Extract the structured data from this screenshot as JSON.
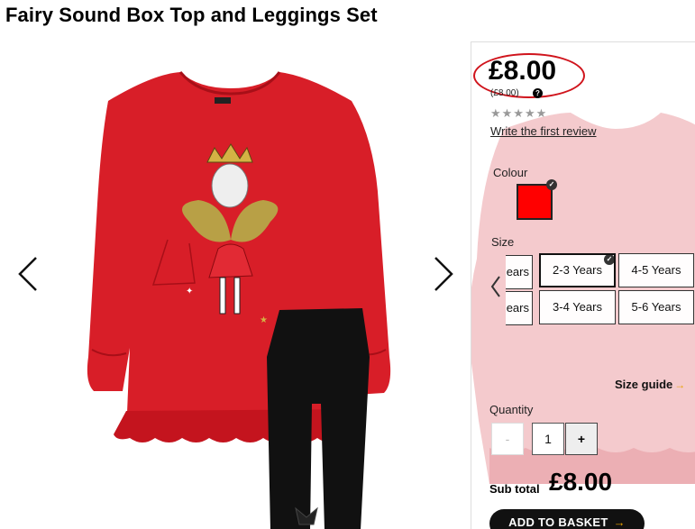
{
  "product": {
    "title": "Fairy Sound Box Top and Leggings Set"
  },
  "gallery": {
    "prev_arrow": "chevron-left-icon",
    "next_arrow": "chevron-right-icon"
  },
  "pricing": {
    "price": "£8.00",
    "unit_price": "(£8.00)",
    "help_icon": "?",
    "stars": "★★★★★",
    "rating_filled": 0,
    "review_link": "Write the first review"
  },
  "colour": {
    "label": "Colour",
    "selected_hex": "#ff0000",
    "check": "✓"
  },
  "size": {
    "label": "Size",
    "options": [
      {
        "label": "ears"
      },
      {
        "label": "2-3 Years"
      },
      {
        "label": "4-5 Years"
      },
      {
        "label": "ears"
      },
      {
        "label": "3-4 Years"
      },
      {
        "label": "5-6 Years"
      }
    ],
    "selected": "2-3 Years",
    "guide": "Size guide",
    "guide_arrow": "→"
  },
  "quantity": {
    "label": "Quantity",
    "minus": "-",
    "value": "1",
    "plus": "+"
  },
  "subtotal": {
    "label": "Sub total",
    "value": "£8.00"
  },
  "basket": {
    "label": "ADD TO BASKET",
    "arrow": "→"
  },
  "colors": {
    "accent_red": "#d0141c",
    "garment_red": "#d81e28",
    "leggings": "#111111",
    "arrow_gold": "#e8a300"
  }
}
